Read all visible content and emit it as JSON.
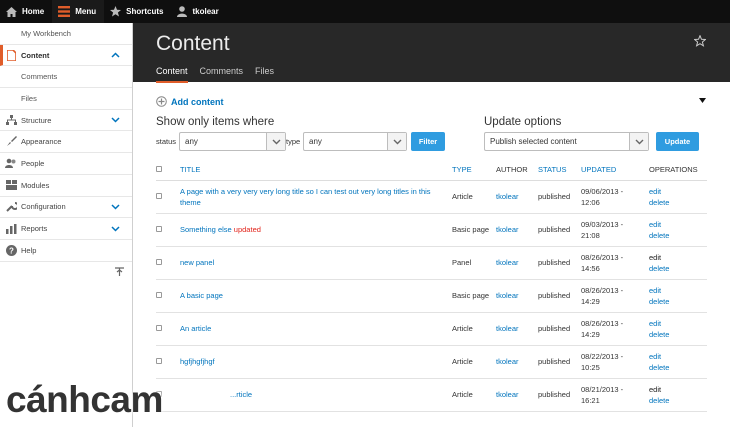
{
  "toolbar": {
    "home": "Home",
    "menu": "Menu",
    "shortcuts": "Shortcuts",
    "user": "tkolear"
  },
  "sidebar": {
    "items": [
      {
        "label": "My Workbench",
        "sub": true
      },
      {
        "label": "Content",
        "active": true
      },
      {
        "label": "Comments",
        "sub": true
      },
      {
        "label": "Files",
        "sub": true
      },
      {
        "label": "Structure"
      },
      {
        "label": "Appearance"
      },
      {
        "label": "People"
      },
      {
        "label": "Modules"
      },
      {
        "label": "Configuration"
      },
      {
        "label": "Reports"
      },
      {
        "label": "Help"
      }
    ]
  },
  "header": {
    "title": "Content",
    "tabs": [
      "Content",
      "Comments",
      "Files"
    ]
  },
  "main": {
    "add_content": "Add content",
    "filter_heading": "Show only items where",
    "status_label": "status",
    "status_value": "any",
    "type_label": "type",
    "type_value": "any",
    "filter_button": "Filter",
    "update_heading": "Update options",
    "update_value": "Publish selected content",
    "update_button": "Update"
  },
  "table": {
    "headers": {
      "title": "TITLE",
      "type": "TYPE",
      "author": "AUTHOR",
      "status": "STATUS",
      "updated": "UPDATED",
      "operations": "OPERATIONS"
    },
    "rows": [
      {
        "title": "A page with a very very very long title so I can test out very long titles in this theme",
        "type": "Article",
        "author": "tkolear",
        "status": "published",
        "date": "09/06/2013 -",
        "time": "12:06",
        "edit": "edit",
        "delete": "delete"
      },
      {
        "title": "Something else ",
        "badge": "updated",
        "type": "Basic page",
        "author": "tkolear",
        "status": "published",
        "date": "09/03/2013 -",
        "time": "21:08",
        "edit": "edit",
        "delete": "delete"
      },
      {
        "title": "new panel",
        "type": "Panel",
        "author": "tkolear",
        "status": "published",
        "date": "08/26/2013 -",
        "time": "14:56",
        "edit": "edit",
        "delete": "delete"
      },
      {
        "title": "A basic page",
        "type": "Basic page",
        "author": "tkolear",
        "status": "published",
        "date": "08/26/2013 -",
        "time": "14:29",
        "edit": "edit",
        "delete": "delete"
      },
      {
        "title": "An article",
        "type": "Article",
        "author": "tkolear",
        "status": "published",
        "date": "08/26/2013 -",
        "time": "14:29",
        "edit": "edit",
        "delete": "delete"
      },
      {
        "title": "hgfjhgfjhgf",
        "type": "Article",
        "author": "tkolear",
        "status": "published",
        "date": "08/22/2013 -",
        "time": "10:25",
        "edit": "edit",
        "delete": "delete"
      },
      {
        "title": "...rticle",
        "type": "Article",
        "author": "tkolear",
        "status": "published",
        "date": "08/21/2013 -",
        "time": "16:21",
        "edit": "edit",
        "delete": "delete"
      }
    ]
  },
  "watermark": "cánhcam",
  "colors": {
    "accent": "#e05d2a",
    "link": "#0074bd",
    "button": "#2f9ce0",
    "toolbar": "#0f0f0f",
    "header": "#282828"
  }
}
